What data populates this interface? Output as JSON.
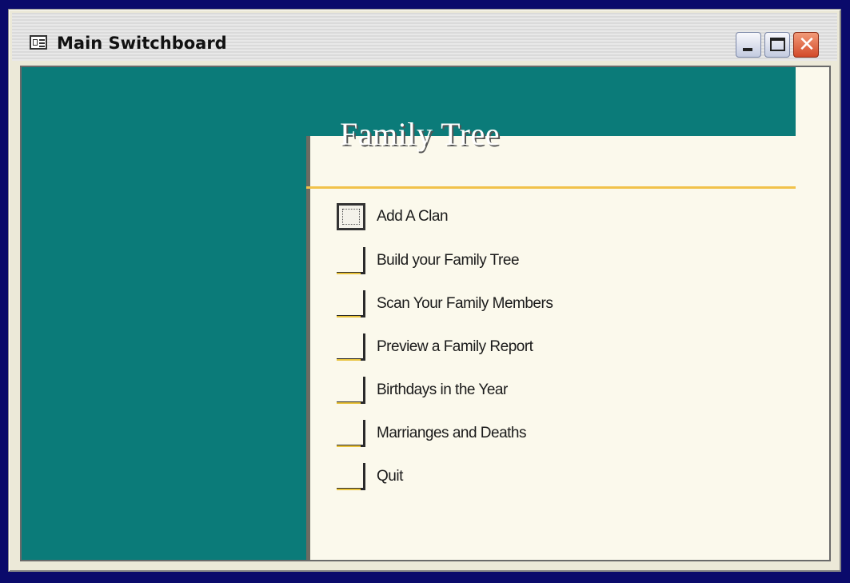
{
  "window": {
    "title": "Main Switchboard",
    "app_icon": "form-icon",
    "controls": {
      "minimize_icon": "minimize-icon",
      "maximize_icon": "maximize-icon",
      "close_glyph": "✕"
    }
  },
  "switchboard": {
    "heading": "Family Tree",
    "items": [
      {
        "label": "Add A Clan",
        "focused": true
      },
      {
        "label": "Build your Family Tree"
      },
      {
        "label": "Scan Your Family Members"
      },
      {
        "label": "Preview a Family Report"
      },
      {
        "label": "Birthdays in the Year"
      },
      {
        "label": "Marrianges and Deaths"
      },
      {
        "label": "Quit"
      }
    ]
  },
  "colors": {
    "teal": "#0b7b79",
    "accent_gold": "#f1c24a",
    "background": "#fbf9ec",
    "desktop": "#0a0a6b"
  }
}
